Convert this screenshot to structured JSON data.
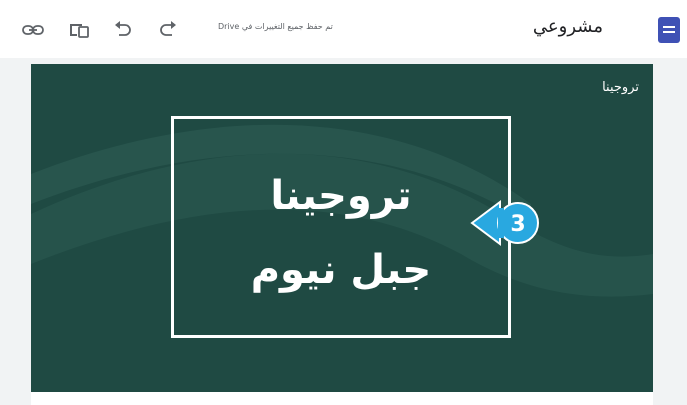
{
  "toolbar": {
    "title": "مشروعي",
    "save_status": "تم حفظ جميع التغييرات في Drive",
    "icons": [
      "link-icon",
      "preview-devices-icon",
      "undo-icon",
      "redo-icon",
      "sites-logo-icon"
    ]
  },
  "hero": {
    "site_name": "تروجينا",
    "title_line1": "تروجينا",
    "title_line2": "جبل نيوم",
    "background_color": "#1f4a43"
  },
  "annotation": {
    "step_number": "3",
    "color": "#29a8e0"
  }
}
